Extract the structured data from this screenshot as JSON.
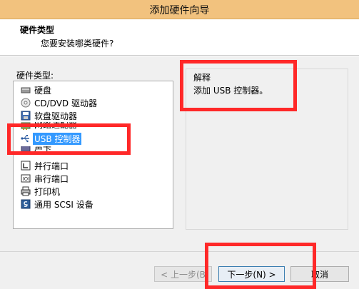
{
  "window": {
    "title": "添加硬件向导"
  },
  "header": {
    "title": "硬件类型",
    "subtitle": "您要安装哪类硬件?"
  },
  "list": {
    "label": "硬件类型:",
    "items": [
      {
        "label": "硬盘",
        "icon": "hard-disk-icon"
      },
      {
        "label": "CD/DVD 驱动器",
        "icon": "cd-dvd-icon"
      },
      {
        "label": "软盘驱动器",
        "icon": "floppy-icon"
      },
      {
        "label": "网络适配器",
        "icon": "network-adapter-icon"
      },
      {
        "label": "USB 控制器",
        "icon": "usb-icon",
        "selected": true
      },
      {
        "label": "声卡",
        "icon": "sound-card-icon"
      },
      {
        "label": "并行端口",
        "icon": "parallel-port-icon"
      },
      {
        "label": "串行端口",
        "icon": "serial-port-icon"
      },
      {
        "label": "打印机",
        "icon": "printer-icon"
      },
      {
        "label": "通用 SCSI 设备",
        "icon": "scsi-icon"
      }
    ]
  },
  "description": {
    "title": "解释",
    "text": "添加 USB 控制器。"
  },
  "buttons": {
    "back": "< 上一步(B",
    "next": "下一步(N) >",
    "cancel": "取消"
  },
  "colors": {
    "annotation": "#ff2828",
    "titlebar": "#f2c27e",
    "selection": "#3399ff"
  }
}
